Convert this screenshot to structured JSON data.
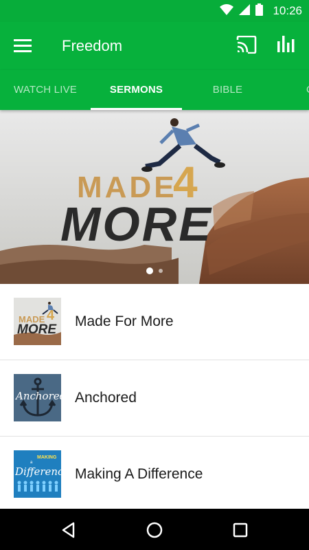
{
  "status_bar": {
    "time": "10:26"
  },
  "app_bar": {
    "title": "Freedom"
  },
  "tabs": [
    {
      "label": "WATCH LIVE",
      "active": false
    },
    {
      "label": "SERMONS",
      "active": true
    },
    {
      "label": "BIBLE",
      "active": false
    },
    {
      "label": "C",
      "active": false
    }
  ],
  "hero": {
    "title_line1": "MADE",
    "title_four": "4",
    "title_line2": "MORE",
    "carousel_index": 1,
    "carousel_count": 2
  },
  "sermons": [
    {
      "title": "Made For More",
      "thumb": {
        "line1": "MADE",
        "four": "4",
        "line2": "MORE"
      }
    },
    {
      "title": "Anchored",
      "thumb": {
        "text": "Anchored"
      }
    },
    {
      "title": "Making A Difference",
      "thumb": {
        "small": "MAKING",
        "small2": "a",
        "big": "Difference"
      }
    }
  ],
  "colors": {
    "primary": "#07b13c",
    "status": "#07ad3a",
    "nav": "#000000"
  }
}
